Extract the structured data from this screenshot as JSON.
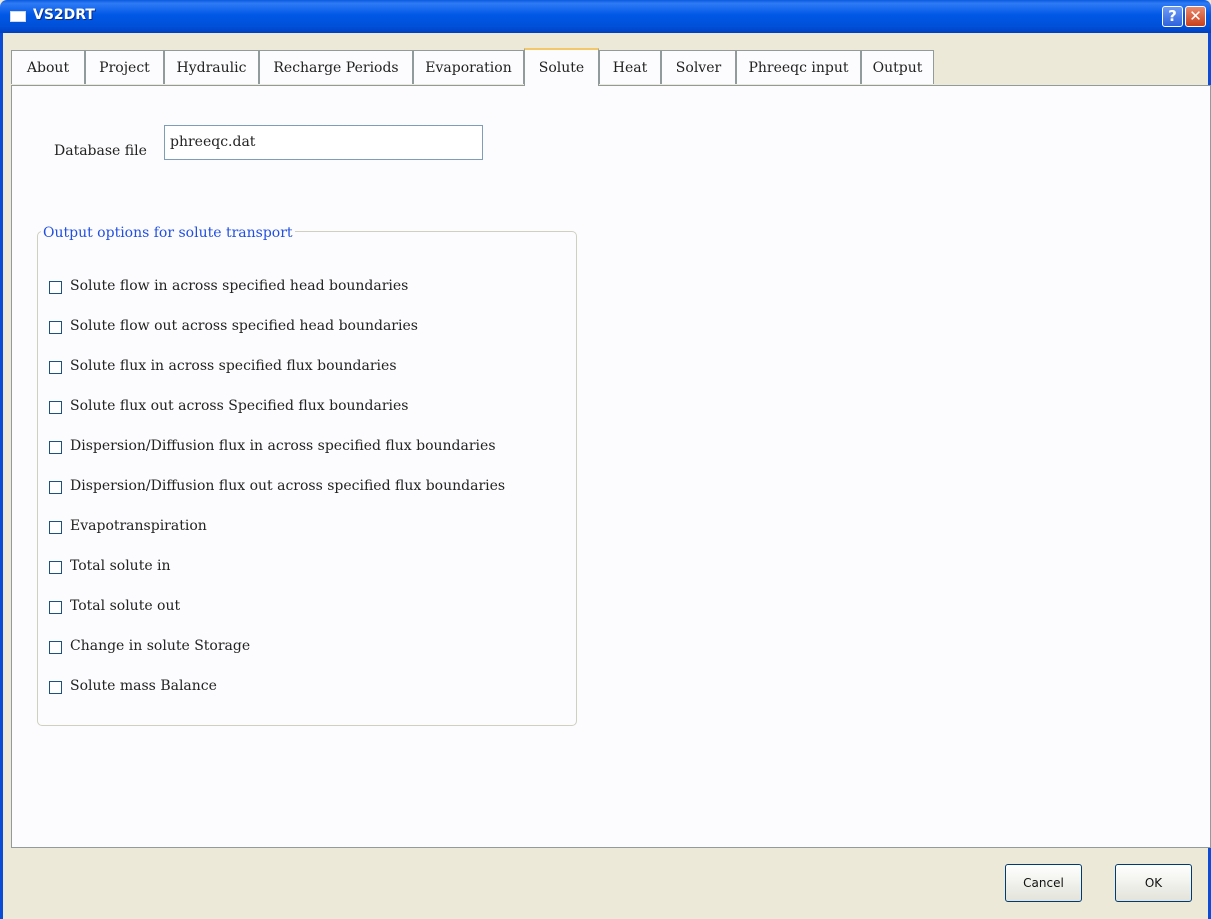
{
  "window": {
    "title": "VS2DRT",
    "help_label": "?",
    "close_label": "✕"
  },
  "tabs": [
    {
      "label": "About"
    },
    {
      "label": "Project"
    },
    {
      "label": "Hydraulic"
    },
    {
      "label": "Recharge Periods"
    },
    {
      "label": "Evaporation"
    },
    {
      "label": "Solute",
      "active": true
    },
    {
      "label": "Heat"
    },
    {
      "label": "Solver"
    },
    {
      "label": "Phreeqc input"
    },
    {
      "label": "Output"
    }
  ],
  "database": {
    "label": "Database file",
    "value": "phreeqc.dat"
  },
  "output_options": {
    "title": "Output options for solute transport",
    "items": [
      {
        "label": "Solute flow in across specified head boundaries",
        "checked": false
      },
      {
        "label": "Solute flow out  across specified head boundaries",
        "checked": false
      },
      {
        "label": "Solute flux in across specified flux boundaries",
        "checked": false
      },
      {
        "label": "Solute flux out across Specified flux boundaries",
        "checked": false
      },
      {
        "label": "Dispersion/Diffusion  flux in across specified flux boundaries",
        "checked": false
      },
      {
        "label": "Dispersion/Diffusion  flux out across specified flux boundaries",
        "checked": false
      },
      {
        "label": "Evapotranspiration",
        "checked": false
      },
      {
        "label": "Total solute in",
        "checked": false
      },
      {
        "label": "Total solute out",
        "checked": false
      },
      {
        "label": "Change in solute Storage",
        "checked": false
      },
      {
        "label": "Solute mass Balance",
        "checked": false
      }
    ]
  },
  "buttons": {
    "cancel": "Cancel",
    "ok": "OK"
  },
  "colors": {
    "titlebar": "#0058e6",
    "group_title": "#2150e0",
    "window_bg": "#ece9d8"
  }
}
